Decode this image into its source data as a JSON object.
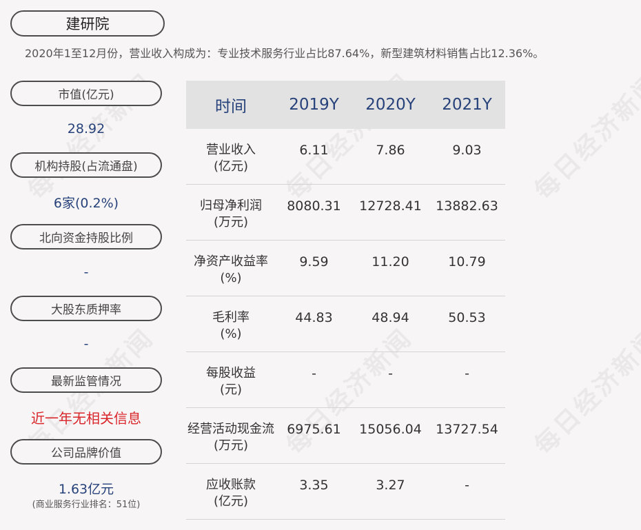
{
  "company": "建研院",
  "summary": "2020年1至12月份，营业收入构成为：专业技术服务行业占比87.64%，新型建筑材料销售占比12.36%。",
  "watermark": "每日经济新闻",
  "sidebar": [
    {
      "label": "市值(亿元)",
      "value": "28.92",
      "sub": ""
    },
    {
      "label": "机构持股(占流通盘)",
      "value": "6家(0.2%)",
      "sub": ""
    },
    {
      "label": "北向资金持股比例",
      "value": "-",
      "sub": ""
    },
    {
      "label": "大股东质押率",
      "value": "-",
      "sub": ""
    },
    {
      "label": "最新监管情况",
      "value": "近一年无相关信息",
      "sub": ""
    },
    {
      "label": "公司品牌价值",
      "value": "1.63亿元",
      "sub": "(商业服务行业排名：51位)"
    }
  ],
  "colors": {
    "accent": "#27427a",
    "alert": "#d8262b"
  },
  "table": {
    "headers": [
      "时间",
      "2019Y",
      "2020Y",
      "2021Y"
    ],
    "rows": [
      {
        "label1": "营业收入",
        "label2": "(亿元)",
        "v": [
          "6.11",
          "7.86",
          "9.03"
        ]
      },
      {
        "label1": "归母净利润",
        "label2": "(万元)",
        "v": [
          "8080.31",
          "12728.41",
          "13882.63"
        ]
      },
      {
        "label1": "净资产收益率",
        "label2": "(%)",
        "v": [
          "9.59",
          "11.20",
          "10.79"
        ]
      },
      {
        "label1": "毛利率",
        "label2": "(%)",
        "v": [
          "44.83",
          "48.94",
          "50.53"
        ]
      },
      {
        "label1": "每股收益",
        "label2": "(元)",
        "v": [
          "-",
          "-",
          "-"
        ]
      },
      {
        "label1": "经营活动现金流",
        "label2": "(万元)",
        "v": [
          "6975.61",
          "15056.04",
          "13727.54"
        ]
      },
      {
        "label1": "应收账款",
        "label2": "(亿元)",
        "v": [
          "3.35",
          "3.27",
          "-"
        ]
      }
    ]
  }
}
